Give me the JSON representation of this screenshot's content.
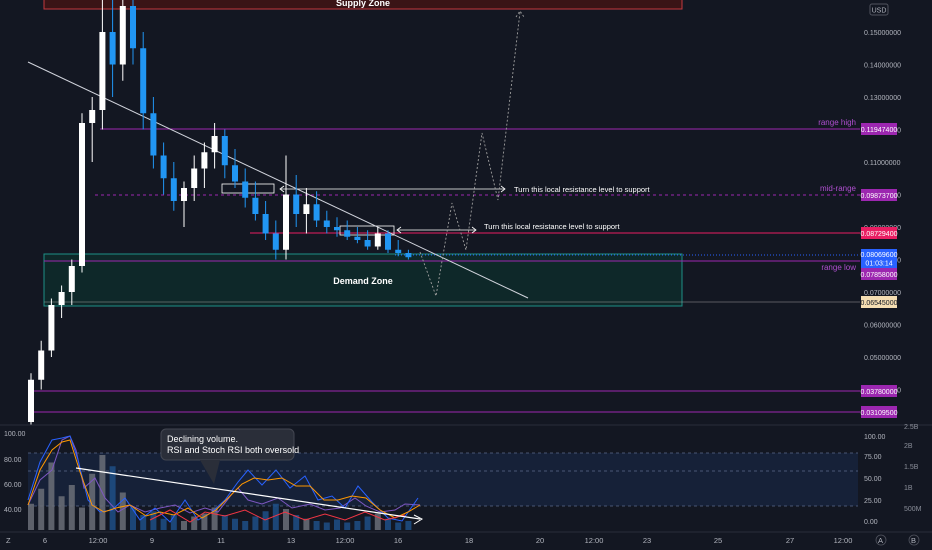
{
  "currency_badge": "USD",
  "zones": {
    "supply": "Supply Zone",
    "demand": "Demand Zone"
  },
  "levels": {
    "range_high": {
      "label": "range high",
      "price": "0.11947400",
      "color": "#9c27b0"
    },
    "mid_range": {
      "label": "mid-range",
      "price": "0.09873700",
      "color": "#9c27b0"
    },
    "resistance": {
      "price": "0.08729400",
      "color": "#e91e63"
    },
    "current": {
      "price": "0.08069600",
      "countdown": "01:03:14",
      "color": "#2962ff"
    },
    "range_low": {
      "label": "range low",
      "price": "0.07858000",
      "color": "#9c27b0"
    },
    "demand_low": {
      "price": "0.06545000",
      "color": "#f5deb3"
    },
    "support1": {
      "price": "0.03780000",
      "color": "#9c27b0"
    },
    "support2": {
      "price": "0.03109500",
      "color": "#9c27b0"
    }
  },
  "annotations": {
    "resistance_note_1": "Turn this local resistance level to support",
    "resistance_note_2": "Turn this local resistance level to support",
    "callout_line1": "Declining volume.",
    "callout_line2": "RSI and Stoch RSI both oversold"
  },
  "price_axis": [
    "0.15000000",
    "0.14000000",
    "0.13000000",
    "0.12000000",
    "0.11000000",
    "0.10000000",
    "0.09000000",
    "0.08000000",
    "0.07000000",
    "0.06000000",
    "0.05000000",
    "0.04000000"
  ],
  "indicator_left_axis": [
    "100.00",
    "80.00",
    "60.00",
    "40.00"
  ],
  "indicator_right_axis": [
    "100.00",
    "75.00",
    "50.00",
    "25.00",
    "0.00"
  ],
  "volume_axis": [
    "2.5B",
    "2B",
    "1.5B",
    "1B",
    "500M"
  ],
  "time_axis": [
    "6",
    "12:00",
    "9",
    "11",
    "13",
    "12:00",
    "16",
    "18",
    "20",
    "12:00",
    "23",
    "25",
    "27",
    "12:00"
  ],
  "bottom_left": "Z",
  "bottom_right": [
    "A",
    "B"
  ],
  "chart_data": {
    "type": "candlestick",
    "ylim": [
      0.028,
      0.162
    ],
    "candles": [
      {
        "o": 0.03,
        "h": 0.045,
        "l": 0.029,
        "c": 0.043
      },
      {
        "o": 0.043,
        "h": 0.055,
        "l": 0.04,
        "c": 0.052
      },
      {
        "o": 0.052,
        "h": 0.068,
        "l": 0.05,
        "c": 0.066
      },
      {
        "o": 0.066,
        "h": 0.072,
        "l": 0.062,
        "c": 0.07
      },
      {
        "o": 0.07,
        "h": 0.08,
        "l": 0.066,
        "c": 0.078
      },
      {
        "o": 0.078,
        "h": 0.125,
        "l": 0.076,
        "c": 0.122
      },
      {
        "o": 0.122,
        "h": 0.13,
        "l": 0.11,
        "c": 0.126
      },
      {
        "o": 0.126,
        "h": 0.16,
        "l": 0.12,
        "c": 0.15
      },
      {
        "o": 0.15,
        "h": 0.162,
        "l": 0.13,
        "c": 0.14
      },
      {
        "o": 0.14,
        "h": 0.162,
        "l": 0.135,
        "c": 0.158
      },
      {
        "o": 0.158,
        "h": 0.161,
        "l": 0.14,
        "c": 0.145
      },
      {
        "o": 0.145,
        "h": 0.15,
        "l": 0.12,
        "c": 0.125
      },
      {
        "o": 0.125,
        "h": 0.13,
        "l": 0.108,
        "c": 0.112
      },
      {
        "o": 0.112,
        "h": 0.116,
        "l": 0.1,
        "c": 0.105
      },
      {
        "o": 0.105,
        "h": 0.11,
        "l": 0.095,
        "c": 0.098
      },
      {
        "o": 0.098,
        "h": 0.104,
        "l": 0.09,
        "c": 0.102
      },
      {
        "o": 0.102,
        "h": 0.112,
        "l": 0.098,
        "c": 0.108
      },
      {
        "o": 0.108,
        "h": 0.116,
        "l": 0.102,
        "c": 0.113
      },
      {
        "o": 0.113,
        "h": 0.122,
        "l": 0.108,
        "c": 0.118
      },
      {
        "o": 0.118,
        "h": 0.12,
        "l": 0.105,
        "c": 0.109
      },
      {
        "o": 0.109,
        "h": 0.114,
        "l": 0.102,
        "c": 0.104
      },
      {
        "o": 0.104,
        "h": 0.108,
        "l": 0.096,
        "c": 0.099
      },
      {
        "o": 0.099,
        "h": 0.104,
        "l": 0.092,
        "c": 0.094
      },
      {
        "o": 0.094,
        "h": 0.098,
        "l": 0.086,
        "c": 0.088
      },
      {
        "o": 0.088,
        "h": 0.092,
        "l": 0.08,
        "c": 0.083
      },
      {
        "o": 0.083,
        "h": 0.112,
        "l": 0.08,
        "c": 0.1
      },
      {
        "o": 0.1,
        "h": 0.106,
        "l": 0.09,
        "c": 0.094
      },
      {
        "o": 0.094,
        "h": 0.102,
        "l": 0.088,
        "c": 0.097
      },
      {
        "o": 0.097,
        "h": 0.101,
        "l": 0.09,
        "c": 0.092
      },
      {
        "o": 0.092,
        "h": 0.095,
        "l": 0.088,
        "c": 0.09
      },
      {
        "o": 0.09,
        "h": 0.093,
        "l": 0.087,
        "c": 0.089
      },
      {
        "o": 0.089,
        "h": 0.092,
        "l": 0.086,
        "c": 0.087
      },
      {
        "o": 0.087,
        "h": 0.09,
        "l": 0.085,
        "c": 0.086
      },
      {
        "o": 0.086,
        "h": 0.089,
        "l": 0.083,
        "c": 0.084
      },
      {
        "o": 0.084,
        "h": 0.09,
        "l": 0.083,
        "c": 0.088
      },
      {
        "o": 0.088,
        "h": 0.089,
        "l": 0.082,
        "c": 0.083
      },
      {
        "o": 0.083,
        "h": 0.086,
        "l": 0.081,
        "c": 0.082
      },
      {
        "o": 0.082,
        "h": 0.083,
        "l": 0.08,
        "c": 0.0807
      }
    ]
  }
}
